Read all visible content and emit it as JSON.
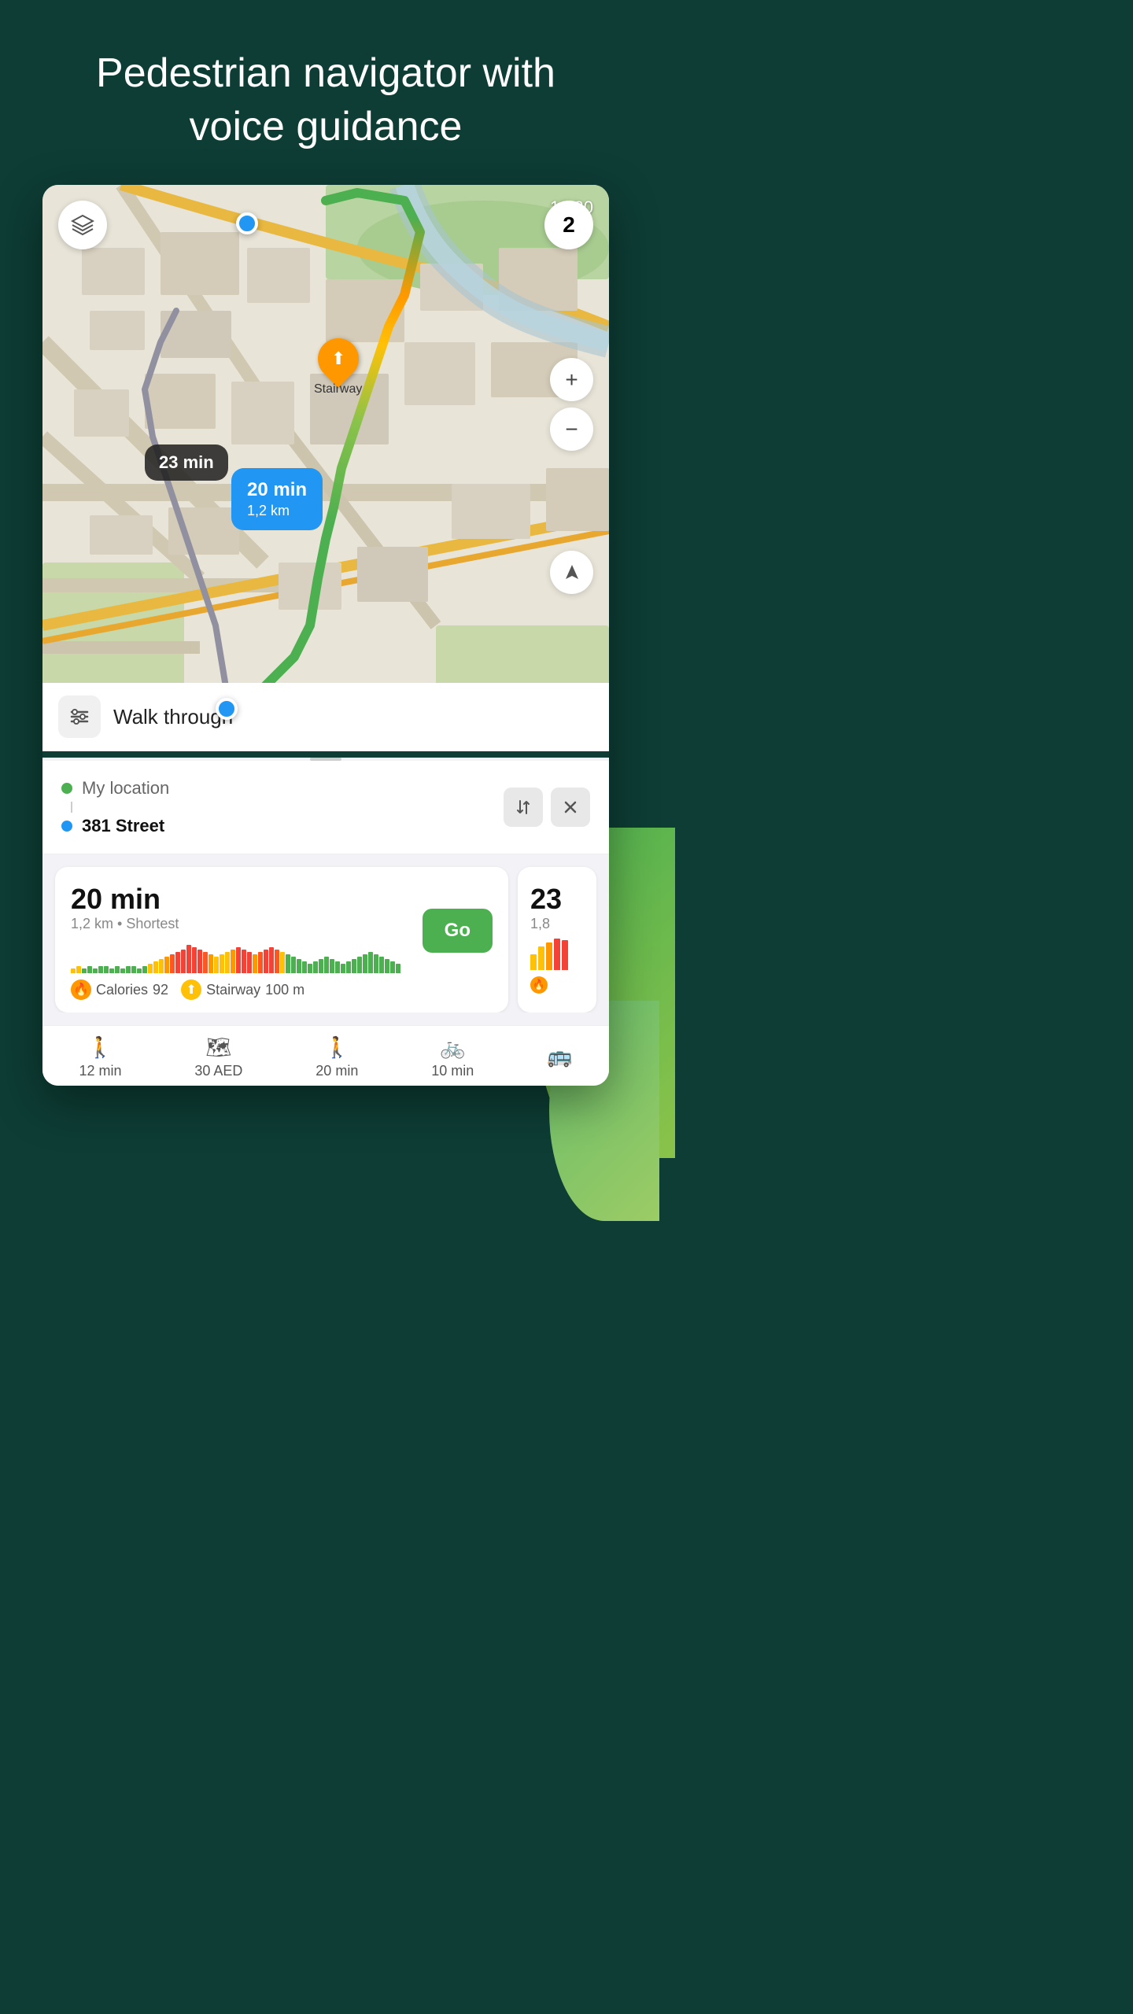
{
  "header": {
    "title": "Pedestrian navigator with voice guidance"
  },
  "map": {
    "time": "12:30",
    "number_badge": "2",
    "bubble_dark": "23 min",
    "bubble_blue_time": "20 min",
    "bubble_blue_dist": "1,2 km",
    "stairway_label": "Stairway",
    "layers_icon": "⊞",
    "zoom_in": "+",
    "zoom_out": "−",
    "nav_icon": "▶"
  },
  "walk_through": {
    "label": "Walk through",
    "filter_icon": "⇌"
  },
  "location": {
    "from": "My location",
    "to": "381 Street"
  },
  "routes": [
    {
      "time": "20 min",
      "distance": "1,2 km",
      "type": "Shortest",
      "calories": "92",
      "stairway": "100 m",
      "go_label": "Go"
    },
    {
      "time": "23",
      "distance": "1,8",
      "partial": true
    }
  ],
  "bottom_tabs": [
    {
      "icon": "🚶",
      "label": "12 min"
    },
    {
      "icon": "🗺",
      "label": "30 AED"
    },
    {
      "icon": "🚶",
      "label": "20 min"
    },
    {
      "icon": "🚲",
      "label": "10 min"
    },
    {
      "icon": "🚌",
      "label": ""
    }
  ],
  "elevation_bars": [
    2,
    3,
    2,
    3,
    2,
    3,
    3,
    2,
    3,
    2,
    3,
    3,
    2,
    3,
    4,
    5,
    6,
    7,
    8,
    9,
    10,
    12,
    11,
    10,
    9,
    8,
    7,
    8,
    9,
    10,
    11,
    10,
    9,
    8,
    9,
    10,
    11,
    10,
    9,
    8,
    7,
    6,
    5,
    4,
    5,
    6,
    7,
    6,
    5,
    4,
    5,
    6,
    7,
    8,
    9,
    8,
    7,
    6,
    5,
    4
  ],
  "elevation_colors": [
    "#ffc107",
    "#ffc107",
    "#4caf50",
    "#4caf50",
    "#4caf50",
    "#4caf50",
    "#4caf50",
    "#4caf50",
    "#4caf50",
    "#4caf50",
    "#4caf50",
    "#4caf50",
    "#4caf50",
    "#4caf50",
    "#ffc107",
    "#ffc107",
    "#ffc107",
    "#ff9800",
    "#ff5722",
    "#f44336",
    "#f44336",
    "#f44336",
    "#f44336",
    "#f44336",
    "#ff5722",
    "#ff9800",
    "#ffc107",
    "#ffc107",
    "#ffc107",
    "#ff9800",
    "#f44336",
    "#f44336",
    "#f44336",
    "#ff9800",
    "#ff5722",
    "#f44336",
    "#f44336",
    "#ff5722",
    "#ffc107",
    "#4caf50",
    "#4caf50",
    "#4caf50",
    "#4caf50",
    "#4caf50",
    "#4caf50",
    "#4caf50",
    "#4caf50",
    "#4caf50",
    "#4caf50",
    "#4caf50",
    "#4caf50",
    "#4caf50",
    "#4caf50",
    "#4caf50",
    "#4caf50",
    "#4caf50",
    "#4caf50",
    "#4caf50",
    "#4caf50",
    "#4caf50"
  ]
}
